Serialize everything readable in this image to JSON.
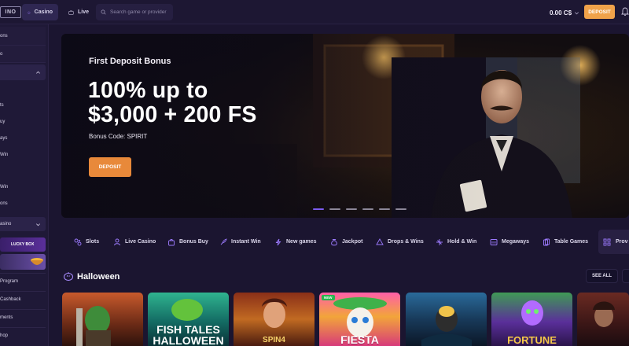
{
  "topbar": {
    "logo_text": "INO",
    "tabs": [
      {
        "label": "Casino",
        "icon": "spade-icon",
        "active": true
      },
      {
        "label": "Live",
        "icon": "tv-icon",
        "active": false
      }
    ],
    "search_placeholder": "Search game or provider",
    "balance": "0.00 C$",
    "deposit_label": "DEPOSIT"
  },
  "sidebar": {
    "items": [
      {
        "label": "ons"
      },
      {
        "label": "o"
      },
      {
        "label": ""
      },
      {
        "label": "ts"
      },
      {
        "label": "uy"
      },
      {
        "label": "ays"
      },
      {
        "label": "Win"
      },
      {
        "label": "Win"
      },
      {
        "label": "ons"
      },
      {
        "label": "asino"
      },
      {
        "label": "Program"
      },
      {
        "label": "Cashback"
      },
      {
        "label": "ments"
      },
      {
        "label": "hop"
      }
    ],
    "lucky_box": "LUCKY BOX"
  },
  "hero": {
    "subtitle": "First Deposit Bonus",
    "title_line1": "100% up to",
    "title_line2": "$3,000 + 200 FS",
    "code": "Bonus Code: SPIRIT",
    "button": "DEPOSIT",
    "slides_total": 6,
    "active_slide": 1
  },
  "categories": [
    {
      "label": "Slots",
      "icon": "slots-icon"
    },
    {
      "label": "Live Casino",
      "icon": "dealer-icon"
    },
    {
      "label": "Bonus Buy",
      "icon": "bag-icon"
    },
    {
      "label": "Instant Win",
      "icon": "rocket-icon"
    },
    {
      "label": "New games",
      "icon": "bolt-icon"
    },
    {
      "label": "Jackpot",
      "icon": "moneybag-icon"
    },
    {
      "label": "Drops & Wins",
      "icon": "drops-icon"
    },
    {
      "label": "Hold & Win",
      "icon": "hold-icon"
    },
    {
      "label": "Megaways",
      "icon": "megaways-icon"
    },
    {
      "label": "Table Games",
      "icon": "cards-icon"
    },
    {
      "label": "Prov",
      "icon": "grid-icon"
    }
  ],
  "section": {
    "title": "Halloween",
    "see_all": "SEE ALL"
  },
  "games": [
    {
      "label": "",
      "colors": [
        "#c9512a",
        "#3f1d12"
      ]
    },
    {
      "label": "FISH TALES HALLOWEEN",
      "colors": [
        "#1f9c7c",
        "#0d3d42"
      ]
    },
    {
      "label": "SPIN4",
      "colors": [
        "#b8621e",
        "#3b1710"
      ]
    },
    {
      "label": "FIESTA",
      "colors": [
        "#e0409a",
        "#f5c23d"
      ],
      "badge": "NEW"
    },
    {
      "label": "",
      "colors": [
        "#1b4e78",
        "#0d1f33"
      ]
    },
    {
      "label": "FORTUNE",
      "colors": [
        "#3a8a4a",
        "#7b2fb0"
      ]
    },
    {
      "label": "",
      "colors": [
        "#5a2620",
        "#1d0f12"
      ]
    }
  ]
}
